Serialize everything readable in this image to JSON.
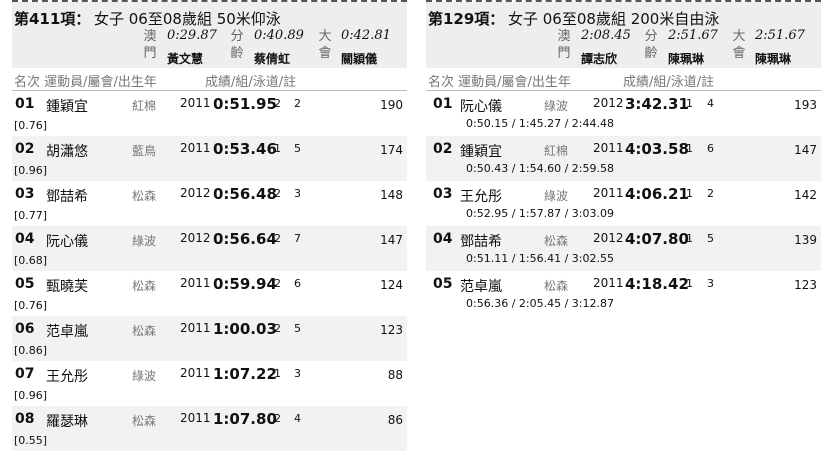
{
  "events": [
    {
      "event_label": "第411項：",
      "event_desc": "女子 06至08歲組 50米仰泳",
      "records": [
        {
          "label": "澳門",
          "time": "0:29.87",
          "holder": "黃文慧"
        },
        {
          "label": "分齡",
          "time": "0:40.89",
          "holder": "蔡倩虹"
        },
        {
          "label": "大會",
          "time": "0:42.81",
          "holder": "關穎儀"
        }
      ],
      "columns": {
        "rank_name": "名次 運動員/屬會/出生年",
        "result": "成績/組/泳道/註"
      },
      "results": [
        {
          "rank": "01",
          "name": "鍾穎宜",
          "club": "紅棉",
          "year": "2011",
          "time": "0:51.95",
          "heat": "2",
          "lane": "2",
          "points": "190",
          "reaction": "[0.76]"
        },
        {
          "rank": "02",
          "name": "胡瀟悠",
          "club": "藍鳥",
          "year": "2011",
          "time": "0:53.46",
          "heat": "1",
          "lane": "5",
          "points": "174",
          "reaction": "[0.96]"
        },
        {
          "rank": "03",
          "name": "鄧喆希",
          "club": "松森",
          "year": "2012",
          "time": "0:56.48",
          "heat": "2",
          "lane": "3",
          "points": "148",
          "reaction": "[0.77]"
        },
        {
          "rank": "04",
          "name": "阮心儀",
          "club": "綠波",
          "year": "2012",
          "time": "0:56.64",
          "heat": "2",
          "lane": "7",
          "points": "147",
          "reaction": "[0.68]"
        },
        {
          "rank": "05",
          "name": "甄曉芙",
          "club": "松森",
          "year": "2011",
          "time": "0:59.94",
          "heat": "2",
          "lane": "6",
          "points": "124",
          "reaction": "[0.76]"
        },
        {
          "rank": "06",
          "name": "范卓嵐",
          "club": "松森",
          "year": "2011",
          "time": "1:00.03",
          "heat": "2",
          "lane": "5",
          "points": "123",
          "reaction": "[0.86]"
        },
        {
          "rank": "07",
          "name": "王允彤",
          "club": "綠波",
          "year": "2011",
          "time": "1:07.22",
          "heat": "1",
          "lane": "3",
          "points": "88",
          "reaction": "[0.96]"
        },
        {
          "rank": "08",
          "name": "羅瑟琳",
          "club": "松森",
          "year": "2011",
          "time": "1:07.80",
          "heat": "2",
          "lane": "4",
          "points": "86",
          "reaction": "[0.55]"
        }
      ]
    },
    {
      "event_label": "第129項：",
      "event_desc": "女子 06至08歲組 200米自由泳",
      "records": [
        {
          "label": "澳門",
          "time": "2:08.45",
          "holder": "譚志欣"
        },
        {
          "label": "分齡",
          "time": "2:51.67",
          "holder": "陳珮琳"
        },
        {
          "label": "大會",
          "time": "2:51.67",
          "holder": "陳珮琳"
        }
      ],
      "columns": {
        "rank_name": "名次 運動員/屬會/出生年",
        "result": "成績/組/泳道/註"
      },
      "results": [
        {
          "rank": "01",
          "name": "阮心儀",
          "club": "綠波",
          "year": "2012",
          "time": "3:42.31",
          "heat": "1",
          "lane": "4",
          "points": "193",
          "splits": "0:50.15 /   1:45.27 /   2:44.48"
        },
        {
          "rank": "02",
          "name": "鍾穎宜",
          "club": "紅棉",
          "year": "2011",
          "time": "4:03.58",
          "heat": "1",
          "lane": "6",
          "points": "147",
          "splits": "0:50.43 /   1:54.60 /   2:59.58"
        },
        {
          "rank": "03",
          "name": "王允彤",
          "club": "綠波",
          "year": "2011",
          "time": "4:06.21",
          "heat": "1",
          "lane": "2",
          "points": "142",
          "splits": "0:52.95 /   1:57.87 /   3:03.09"
        },
        {
          "rank": "04",
          "name": "鄧喆希",
          "club": "松森",
          "year": "2012",
          "time": "4:07.80",
          "heat": "1",
          "lane": "5",
          "points": "139",
          "splits": "0:51.11 /   1:56.41 /   3:02.55"
        },
        {
          "rank": "05",
          "name": "范卓嵐",
          "club": "松森",
          "year": "2011",
          "time": "4:18.42",
          "heat": "1",
          "lane": "3",
          "points": "123",
          "splits": "0:56.36 /   2:05.45 /   3:12.87"
        }
      ]
    }
  ]
}
